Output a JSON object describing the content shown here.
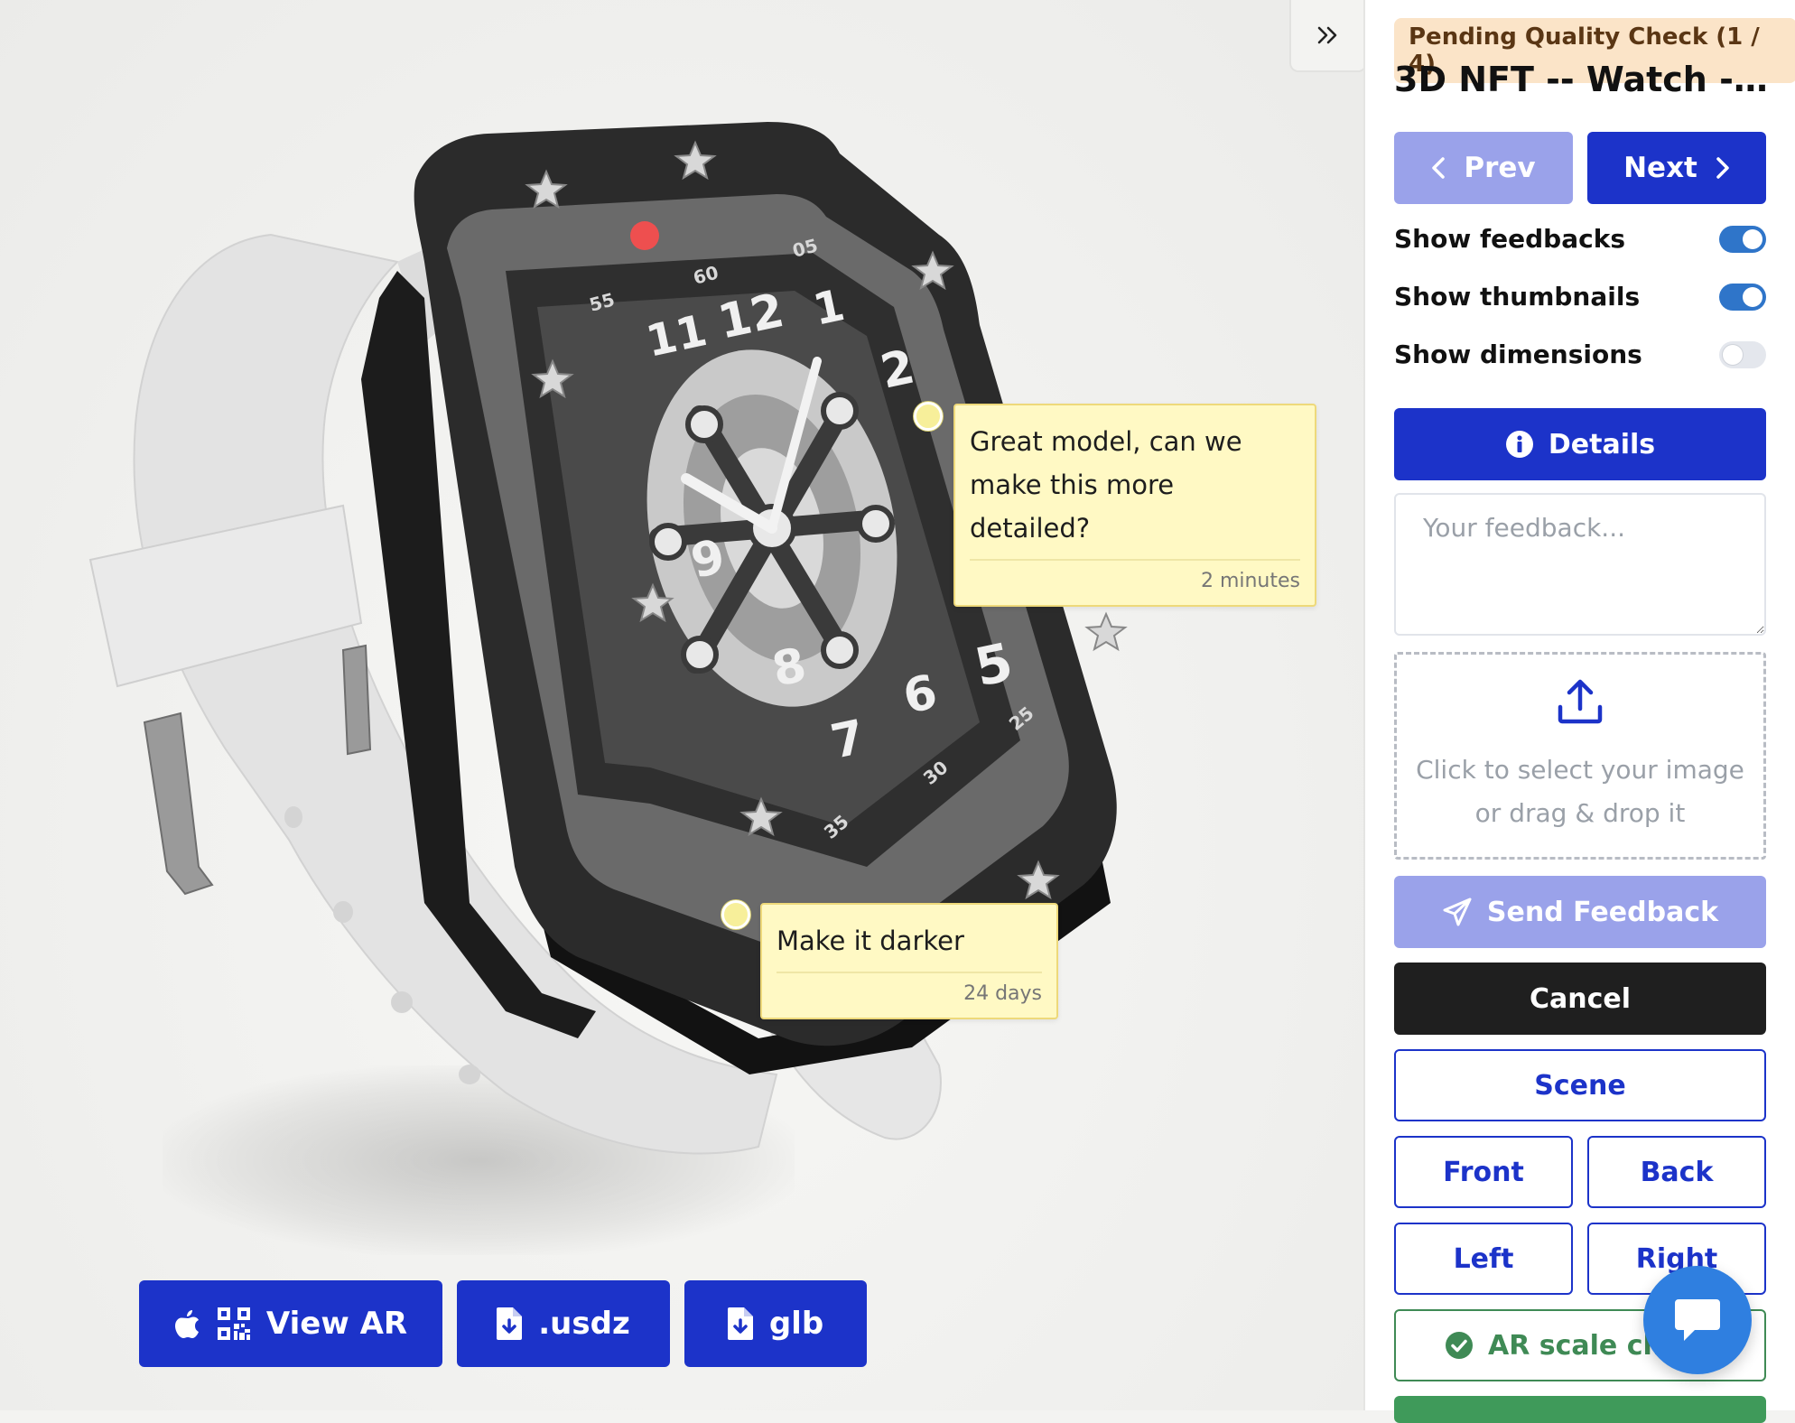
{
  "viewer": {
    "notes": [
      {
        "text_line1": "Great model, can we",
        "text_line2": "make this more detailed?",
        "time": "2 minutes"
      },
      {
        "text_line1": "Make it darker",
        "time": "24 days"
      }
    ],
    "ar_buttons": {
      "view_ar": "View AR",
      "usdz": ".usdz",
      "glb": "glb"
    },
    "watch_numerals": [
      "55",
      "60",
      "05",
      "12",
      "1",
      "2",
      "5",
      "6",
      "7",
      "8",
      "9",
      "11",
      "25",
      "30",
      "35"
    ]
  },
  "sidebar": {
    "status": "Pending Quality Check (1 / 4)",
    "title": "3D NFT -- Watch -- ...",
    "prev_label": "Prev",
    "next_label": "Next",
    "toggles": [
      {
        "label": "Show feedbacks",
        "on": true
      },
      {
        "label": "Show thumbnails",
        "on": true
      },
      {
        "label": "Show dimensions",
        "on": false
      }
    ],
    "details_label": "Details",
    "feedback_placeholder": "Your feedback...",
    "dropzone_line1": "Click to select your image",
    "dropzone_line2": "or drag & drop it",
    "send_label": "Send Feedback",
    "cancel_label": "Cancel",
    "scene_label": "Scene",
    "front_label": "Front",
    "back_label": "Back",
    "left_label": "Left",
    "right_label": "Right",
    "ar_check_label": "AR scale che"
  },
  "colors": {
    "primary": "#1c33c9",
    "primary_light": "#9aa2ea",
    "note_bg": "#fff9c4",
    "success": "#3f8a55",
    "chat": "#2f7fe0"
  }
}
